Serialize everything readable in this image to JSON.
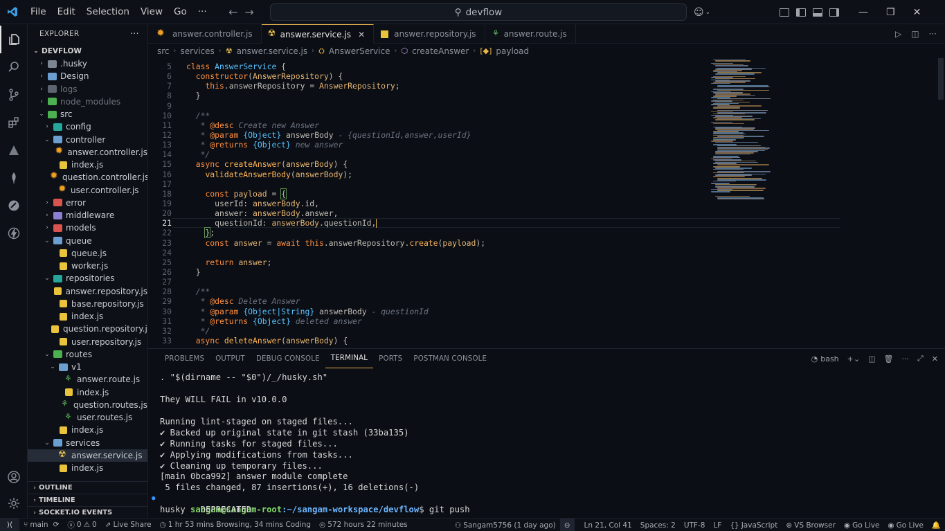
{
  "titlebar": {
    "menu": [
      "File",
      "Edit",
      "Selection",
      "View",
      "Go",
      "···"
    ],
    "search": "devflow"
  },
  "sidebar": {
    "title": "EXPLORER",
    "root": "DEVFLOW",
    "tree": [
      {
        "label": ".husky",
        "depth": 0,
        "type": "folder",
        "icon": "folder-husky",
        "open": false
      },
      {
        "label": "Design",
        "depth": 0,
        "type": "folder",
        "icon": "folder",
        "open": false
      },
      {
        "label": "logs",
        "depth": 0,
        "type": "folder",
        "icon": "folder-grey",
        "open": false,
        "dim": true
      },
      {
        "label": "node_modules",
        "depth": 0,
        "type": "folder",
        "icon": "folder-src",
        "open": false,
        "dim": true
      },
      {
        "label": "src",
        "depth": 0,
        "type": "folder",
        "icon": "folder-src",
        "open": true
      },
      {
        "label": "config",
        "depth": 1,
        "type": "folder",
        "icon": "folder-teal",
        "open": false
      },
      {
        "label": "controller",
        "depth": 1,
        "type": "folder",
        "icon": "folder",
        "open": true
      },
      {
        "label": "answer.controller.js",
        "depth": 2,
        "type": "gear"
      },
      {
        "label": "index.js",
        "depth": 2,
        "type": "js"
      },
      {
        "label": "question.controller.js",
        "depth": 2,
        "type": "gear"
      },
      {
        "label": "user.controller.js",
        "depth": 2,
        "type": "gear"
      },
      {
        "label": "error",
        "depth": 1,
        "type": "folder",
        "icon": "folder-red",
        "open": false
      },
      {
        "label": "middleware",
        "depth": 1,
        "type": "folder",
        "icon": "folder-purple",
        "open": false
      },
      {
        "label": "models",
        "depth": 1,
        "type": "folder",
        "icon": "folder-red",
        "open": false
      },
      {
        "label": "queue",
        "depth": 1,
        "type": "folder",
        "icon": "folder",
        "open": true
      },
      {
        "label": "queue.js",
        "depth": 2,
        "type": "js"
      },
      {
        "label": "worker.js",
        "depth": 2,
        "type": "js"
      },
      {
        "label": "repositories",
        "depth": 1,
        "type": "folder",
        "icon": "folder-teal",
        "open": true
      },
      {
        "label": "answer.repository.js",
        "depth": 2,
        "type": "js"
      },
      {
        "label": "base.repository.js",
        "depth": 2,
        "type": "js"
      },
      {
        "label": "index.js",
        "depth": 2,
        "type": "js"
      },
      {
        "label": "question.repository.js",
        "depth": 2,
        "type": "js"
      },
      {
        "label": "user.repository.js",
        "depth": 2,
        "type": "js"
      },
      {
        "label": "routes",
        "depth": 1,
        "type": "folder",
        "icon": "folder-src",
        "open": true
      },
      {
        "label": "v1",
        "depth": 2,
        "type": "folder",
        "icon": "folder",
        "open": true
      },
      {
        "label": "answer.route.js",
        "depth": 3,
        "type": "route"
      },
      {
        "label": "index.js",
        "depth": 3,
        "type": "js"
      },
      {
        "label": "question.routes.js",
        "depth": 3,
        "type": "route"
      },
      {
        "label": "user.routes.js",
        "depth": 3,
        "type": "route"
      },
      {
        "label": "index.js",
        "depth": 2,
        "type": "js"
      },
      {
        "label": "services",
        "depth": 1,
        "type": "folder",
        "icon": "folder",
        "open": true
      },
      {
        "label": "answer.service.js",
        "depth": 2,
        "type": "svc",
        "selected": true
      },
      {
        "label": "index.js",
        "depth": 2,
        "type": "js"
      }
    ],
    "sections": [
      "OUTLINE",
      "TIMELINE",
      "SOCKET.IO EVENTS"
    ]
  },
  "tabs": [
    {
      "label": "answer.controller.js",
      "type": "gear"
    },
    {
      "label": "answer.service.js",
      "type": "svc",
      "active": true
    },
    {
      "label": "answer.repository.js",
      "type": "js"
    },
    {
      "label": "answer.route.js",
      "type": "route"
    }
  ],
  "breadcrumb": {
    "src": "src",
    "services": "services",
    "file": "answer.service.js",
    "cls": "AnswerService",
    "method": "createAnswer",
    "param": "payload"
  },
  "editor": {
    "current_line": 21,
    "lines": [
      {
        "n": "5",
        "t": [
          [
            "kw",
            "class "
          ],
          [
            "cls",
            "AnswerService "
          ],
          [
            "pn",
            "{"
          ]
        ]
      },
      {
        "n": "6",
        "t": [
          [
            "pn",
            "  "
          ],
          [
            "kw",
            "constructor"
          ],
          [
            "pn",
            "("
          ],
          [
            "tag",
            "AnswerRepository"
          ],
          [
            "pn",
            ") {"
          ]
        ]
      },
      {
        "n": "7",
        "t": [
          [
            "pn",
            "    "
          ],
          [
            "kw",
            "this"
          ],
          [
            "pn",
            ".answerRepository = "
          ],
          [
            "tag",
            "AnswerRepository"
          ],
          [
            "pn",
            ";"
          ]
        ]
      },
      {
        "n": "8",
        "t": [
          [
            "pn",
            "  }"
          ]
        ]
      },
      {
        "n": "9",
        "t": []
      },
      {
        "n": "10",
        "t": [
          [
            "cm",
            "  /**"
          ]
        ]
      },
      {
        "n": "11",
        "t": [
          [
            "cm",
            "   * "
          ],
          [
            "kw",
            "@desc"
          ],
          [
            "cm",
            " Create new Answer"
          ]
        ]
      },
      {
        "n": "12",
        "t": [
          [
            "cm",
            "   * "
          ],
          [
            "kw",
            "@param"
          ],
          [
            "cm",
            " "
          ],
          [
            "typ",
            "{Object}"
          ],
          [
            "pn",
            " answerBody"
          ],
          [
            "cm",
            " - {questionId,answer,userId}"
          ]
        ]
      },
      {
        "n": "13",
        "t": [
          [
            "cm",
            "   * "
          ],
          [
            "kw",
            "@returns"
          ],
          [
            "cm",
            " "
          ],
          [
            "typ",
            "{Object}"
          ],
          [
            "cm",
            " new answer"
          ]
        ]
      },
      {
        "n": "14",
        "t": [
          [
            "cm",
            "   */"
          ]
        ]
      },
      {
        "n": "15",
        "t": [
          [
            "pn",
            "  "
          ],
          [
            "kw",
            "async "
          ],
          [
            "fn",
            "createAnswer"
          ],
          [
            "pn",
            "("
          ],
          [
            "tag",
            "answerBody"
          ],
          [
            "pn",
            ") {"
          ]
        ]
      },
      {
        "n": "16",
        "t": [
          [
            "pn",
            "    "
          ],
          [
            "fn",
            "validateAnswerBody"
          ],
          [
            "pn",
            "("
          ],
          [
            "tag",
            "answerBody"
          ],
          [
            "pn",
            ");"
          ]
        ]
      },
      {
        "n": "17",
        "t": []
      },
      {
        "n": "18",
        "t": [
          [
            "pn",
            "    "
          ],
          [
            "kw",
            "const "
          ],
          [
            "tag",
            "payload"
          ],
          [
            "pn",
            " = "
          ],
          [
            "brkt",
            "{"
          ]
        ]
      },
      {
        "n": "19",
        "t": [
          [
            "pn",
            "      userId: "
          ],
          [
            "tag",
            "answerBody"
          ],
          [
            "pn",
            ".id,"
          ]
        ]
      },
      {
        "n": "20",
        "t": [
          [
            "pn",
            "      answer: "
          ],
          [
            "tag",
            "answerBody"
          ],
          [
            "pn",
            ".answer,"
          ]
        ]
      },
      {
        "n": "21",
        "t": [
          [
            "pn",
            "      questionId: "
          ],
          [
            "tag",
            "answerBody"
          ],
          [
            "pn",
            ".questionId,"
          ]
        ]
      },
      {
        "n": "22",
        "t": [
          [
            "pn",
            "    "
          ],
          [
            "brkt",
            "}"
          ],
          [
            "pn",
            ";"
          ]
        ]
      },
      {
        "n": "23",
        "t": [
          [
            "pn",
            "    "
          ],
          [
            "kw",
            "const "
          ],
          [
            "tag",
            "answer"
          ],
          [
            "pn",
            " = "
          ],
          [
            "kw",
            "await "
          ],
          [
            "kw",
            "this"
          ],
          [
            "pn",
            ".answerRepository."
          ],
          [
            "fn",
            "create"
          ],
          [
            "pn",
            "("
          ],
          [
            "tag",
            "payload"
          ],
          [
            "pn",
            ");"
          ]
        ]
      },
      {
        "n": "24",
        "t": []
      },
      {
        "n": "25",
        "t": [
          [
            "pn",
            "    "
          ],
          [
            "kw",
            "return "
          ],
          [
            "tag",
            "answer"
          ],
          [
            "pn",
            ";"
          ]
        ]
      },
      {
        "n": "26",
        "t": [
          [
            "pn",
            "  }"
          ]
        ]
      },
      {
        "n": "27",
        "t": []
      },
      {
        "n": "28",
        "t": [
          [
            "cm",
            "  /**"
          ]
        ]
      },
      {
        "n": "29",
        "t": [
          [
            "cm",
            "   * "
          ],
          [
            "kw",
            "@desc"
          ],
          [
            "cm",
            " Delete Answer"
          ]
        ]
      },
      {
        "n": "30",
        "t": [
          [
            "cm",
            "   * "
          ],
          [
            "kw",
            "@param"
          ],
          [
            "cm",
            " "
          ],
          [
            "typ",
            "{Object|String}"
          ],
          [
            "pn",
            " answerBody"
          ],
          [
            "cm",
            " - questionId"
          ]
        ]
      },
      {
        "n": "31",
        "t": [
          [
            "cm",
            "   * "
          ],
          [
            "kw",
            "@returns"
          ],
          [
            "cm",
            " "
          ],
          [
            "typ",
            "{Object}"
          ],
          [
            "cm",
            " deleted answer"
          ]
        ]
      },
      {
        "n": "32",
        "t": [
          [
            "cm",
            "   */"
          ]
        ]
      },
      {
        "n": "33",
        "t": [
          [
            "pn",
            "  "
          ],
          [
            "kw",
            "async "
          ],
          [
            "fn",
            "deleteAnswer"
          ],
          [
            "pn",
            "("
          ],
          [
            "tag",
            "answerBody"
          ],
          [
            "pn",
            ") {"
          ]
        ]
      }
    ]
  },
  "panel": {
    "tabs": [
      "PROBLEMS",
      "OUTPUT",
      "DEBUG CONSOLE",
      "TERMINAL",
      "PORTS",
      "POSTMAN CONSOLE"
    ],
    "active_tab": "TERMINAL",
    "shell": "bash"
  },
  "terminal": {
    "lines": [
      ". \"$(dirname -- \"$0\")/_/husky.sh\"",
      "",
      "They WILL FAIL in v10.0.0",
      "",
      "Running lint-staged on staged files...",
      "✔ Backed up original state in git stash (33ba135)",
      "✔ Running tasks for staged files...",
      "✔ Applying modifications from tasks...",
      "✔ Cleaning up temporary files...",
      "[main 0bca992] answer module complete",
      " 5 files changed, 87 insertions(+), 16 deletions(-)"
    ],
    "prompt_user": "sangam@sangam-root",
    "prompt_path": ":~/sangam-workspace/devflow",
    "prompt_cmd": "$ git push",
    "last_line": "husky - DEPRECATED"
  },
  "statusbar": {
    "branch": "main",
    "errors": "0",
    "warnings": "0",
    "live_share": "Live Share",
    "time_tracking": "1 hr 53 mins Browsing, 34 mins Coding",
    "total_hours": "572 hours 22 minutes",
    "blame": "Sangam5756 (1 day ago)",
    "position": "Ln 21, Col 41",
    "spaces": "Spaces: 2",
    "encoding": "UTF-8",
    "eol": "LF",
    "language": "JavaScript",
    "vs_browser": "VS Browser",
    "go_live_1": "Go Live",
    "go_live_2": "Go Live"
  }
}
